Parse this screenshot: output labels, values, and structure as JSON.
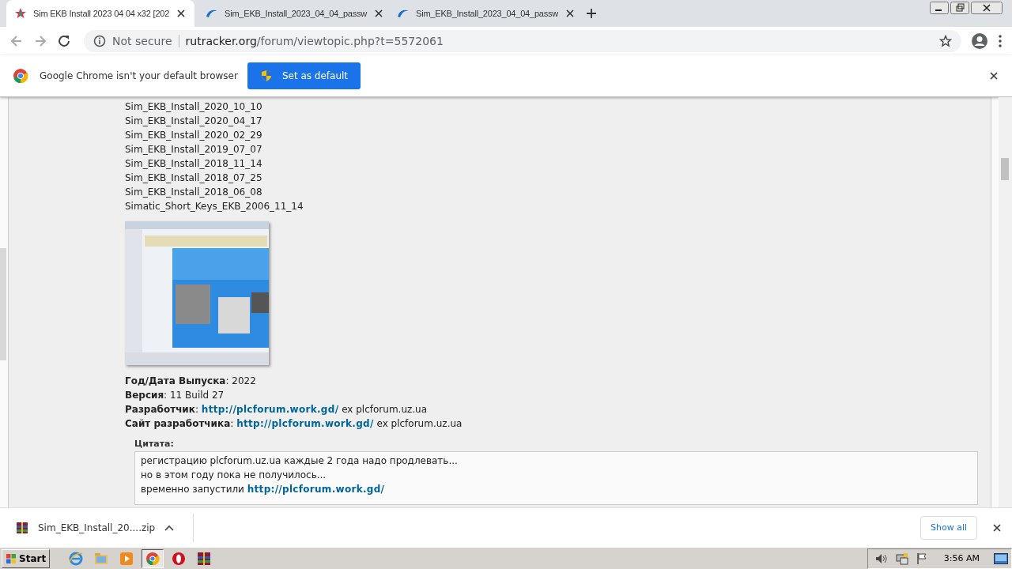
{
  "tabs": [
    {
      "title": "Sim EKB Install 2023 04 04 x32 [202",
      "kind": "star",
      "selected": true
    },
    {
      "title": "Sim_EKB_Install_2023_04_04_passw",
      "kind": "swoosh",
      "selected": false
    },
    {
      "title": "Sim_EKB_Install_2023_04_04_passw",
      "kind": "swoosh",
      "selected": false
    }
  ],
  "address_bar": {
    "security": "Not secure",
    "domain": "rutracker.org",
    "path": "/forum/viewtopic.php?t=5572061"
  },
  "infobar": {
    "message": "Google Chrome isn't your default browser",
    "button": "Set as default"
  },
  "post": {
    "file_list": [
      "Sim_EKB_Install_2020_10_10",
      "Sim_EKB_Install_2020_04_17",
      "Sim_EKB_Install_2020_02_29",
      "Sim_EKB_Install_2019_07_07",
      "Sim_EKB_Install_2018_11_14",
      "Sim_EKB_Install_2018_07_25",
      "Sim_EKB_Install_2018_06_08",
      "Simatic_Short_Keys_EKB_2006_11_14"
    ],
    "details": [
      {
        "text": "**Год/Дата Выпуска**: 2022"
      },
      {
        "text": "**Версия**: 11 Build 27"
      },
      {
        "text": "**Разработчик**:",
        "link": "http://plcforum.work.gd/",
        "after": "ex plcforum.uz.ua"
      },
      {
        "text": "**Сайт разработчика**:",
        "link": "http://plcforum.work.gd/",
        "after": "ex plcforum.uz.ua"
      }
    ],
    "quote": {
      "title": "Цитата:",
      "lines": [
        {
          "text": "регистрацию plcforum.uz.ua каждые 2 года надо продлевать..."
        },
        {
          "text": "но в этом году пока не получилось..."
        },
        {
          "text": "временно запустили",
          "link": "http://plcforum.work.gd/"
        }
      ]
    }
  },
  "downloads": {
    "file": "Sim_EKB_Install_20....zip",
    "show_all": "Show all"
  },
  "taskbar": {
    "start": "Start",
    "apps": [
      {
        "kind": "ie",
        "selected": false
      },
      {
        "kind": "folder",
        "selected": false
      },
      {
        "kind": "media",
        "selected": false
      },
      {
        "kind": "chrome",
        "selected": true
      },
      {
        "kind": "opera",
        "selected": false
      },
      {
        "kind": "archive",
        "selected": false
      }
    ],
    "clock": "3:56 AM"
  }
}
